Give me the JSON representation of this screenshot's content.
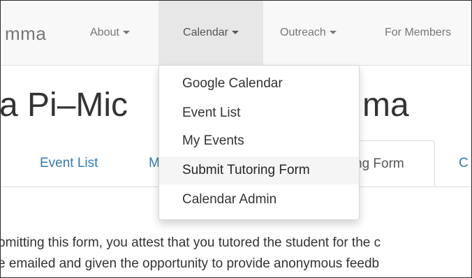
{
  "navbar": {
    "brand": "mma",
    "items": [
      {
        "label": "About"
      },
      {
        "label": "Calendar"
      },
      {
        "label": "Outreach"
      },
      {
        "label": "For Members"
      }
    ]
  },
  "heading": "a Pi–Mic",
  "heading_right": "ma",
  "tabs": [
    {
      "label": "Event List"
    },
    {
      "label": "M"
    },
    {
      "label": "ng Form"
    },
    {
      "label": "C"
    }
  ],
  "calendar_menu": {
    "items": [
      {
        "label": "Google Calendar"
      },
      {
        "label": "Event List"
      },
      {
        "label": "My Events"
      },
      {
        "label": "Submit Tutoring Form"
      },
      {
        "label": "Calendar Admin"
      }
    ],
    "highlighted": "Submit Tutoring Form"
  },
  "body": {
    "line1": "bmitting this form, you attest that you tutored the student for the c",
    "line2": "e emailed and given the opportunity to provide anonymous feedb"
  },
  "colors": {
    "navbar_bg": "#f8f8f8",
    "active_nav_bg": "#e7e7e7",
    "link": "#337ab7",
    "text": "#333333",
    "muted": "#777777"
  }
}
